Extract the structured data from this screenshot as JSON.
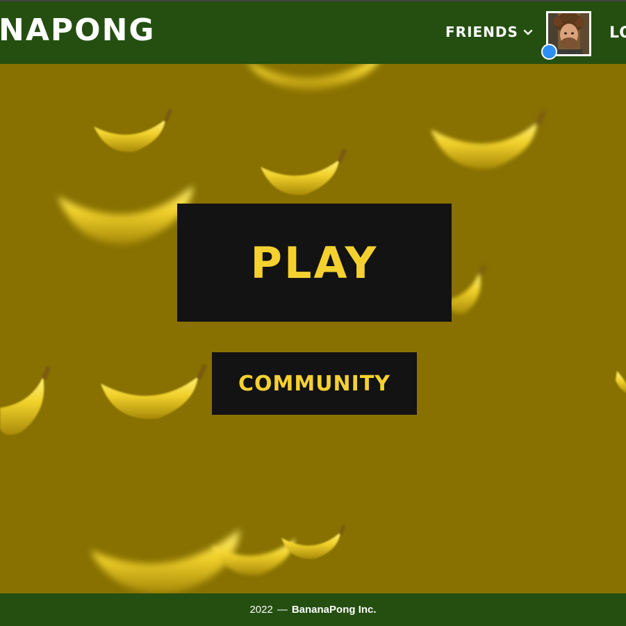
{
  "header": {
    "logo_text": "ANAPONG",
    "friends_label": "FRIENDS",
    "logout_label": "LO",
    "user": {
      "status_color": "#2c8ff5"
    }
  },
  "main": {
    "play_label": "PLAY",
    "community_label": "COMMUNITY"
  },
  "footer": {
    "year": "2022",
    "separator": "—",
    "company": "BananaPong Inc."
  },
  "theme": {
    "header_bg": "#244f10",
    "page_bg": "#887100",
    "button_bg": "#131313",
    "button_text": "#f5d130",
    "footer_bg": "#244f10"
  }
}
